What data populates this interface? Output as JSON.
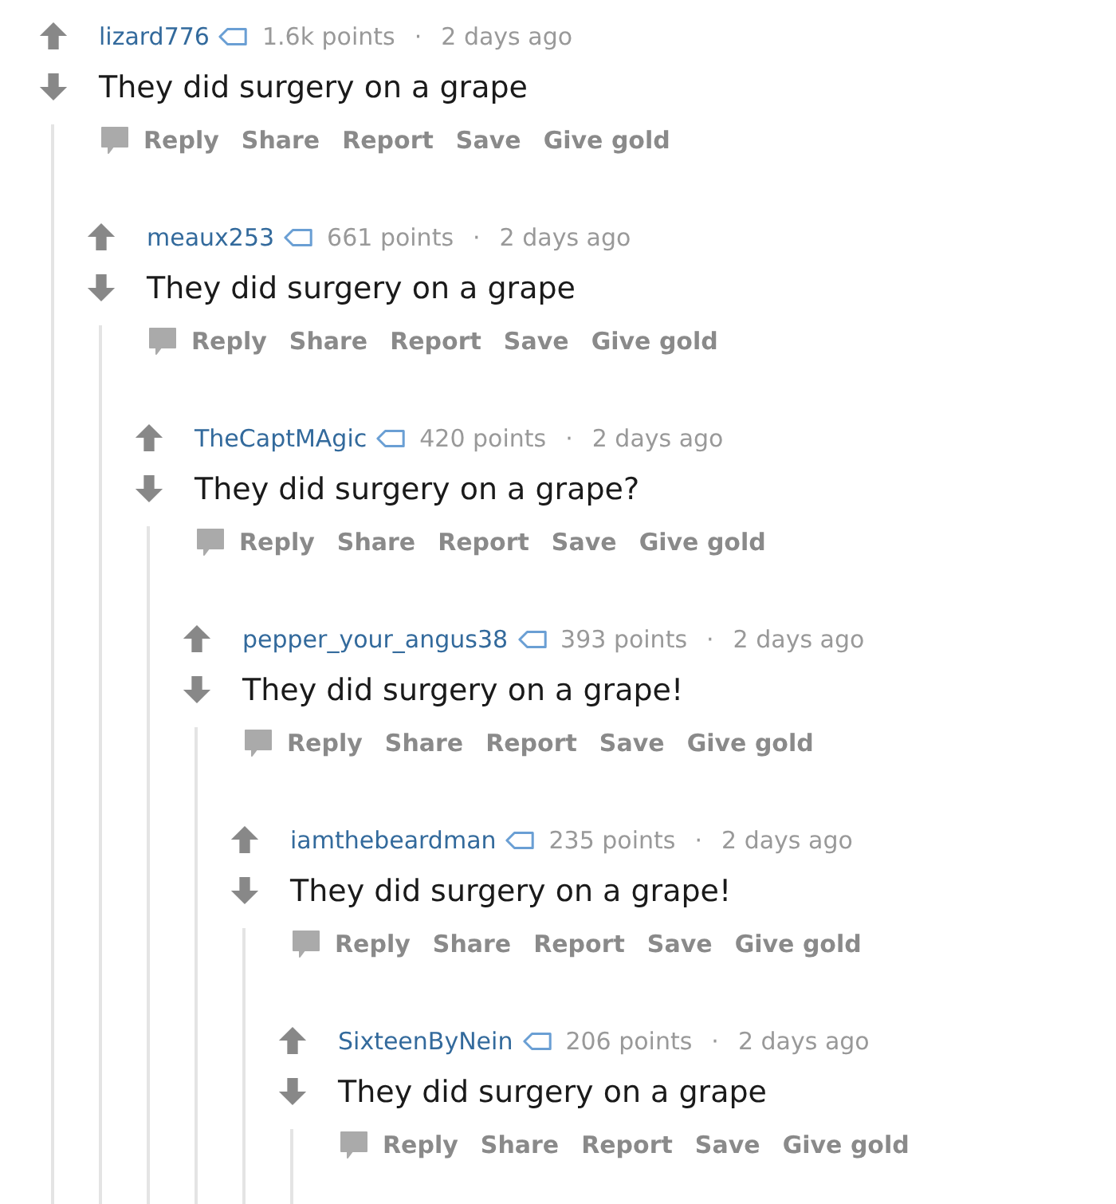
{
  "comments": [
    {
      "author": "lizard776",
      "points": "1.6k points",
      "separator": "·",
      "age": "2 days ago",
      "body": "They did surgery on a grape",
      "actions": [
        "Reply",
        "Share",
        "Report",
        "Save",
        "Give gold"
      ],
      "children": [
        {
          "author": "meaux253",
          "points": "661 points",
          "separator": "·",
          "age": "2 days ago",
          "body": "They did surgery on a grape",
          "actions": [
            "Reply",
            "Share",
            "Report",
            "Save",
            "Give gold"
          ],
          "children": [
            {
              "author": "TheCaptMAgic",
              "points": "420 points",
              "separator": "·",
              "age": "2 days ago",
              "body": "They did surgery on a grape?",
              "actions": [
                "Reply",
                "Share",
                "Report",
                "Save",
                "Give gold"
              ],
              "children": [
                {
                  "author": "pepper_your_angus38",
                  "points": "393 points",
                  "separator": "·",
                  "age": "2 days ago",
                  "body": "They did surgery on a grape!",
                  "actions": [
                    "Reply",
                    "Share",
                    "Report",
                    "Save",
                    "Give gold"
                  ],
                  "children": [
                    {
                      "author": "iamthebeardman",
                      "points": "235 points",
                      "separator": "·",
                      "age": "2 days ago",
                      "body": "They did surgery on a grape!",
                      "actions": [
                        "Reply",
                        "Share",
                        "Report",
                        "Save",
                        "Give gold"
                      ],
                      "children": [
                        {
                          "author": "SixteenByNein",
                          "points": "206 points",
                          "separator": "·",
                          "age": "2 days ago",
                          "body": "They did surgery on a grape",
                          "actions": [
                            "Reply",
                            "Share",
                            "Report",
                            "Save",
                            "Give gold"
                          ]
                        }
                      ]
                    }
                  ]
                }
              ]
            }
          ]
        }
      ]
    }
  ]
}
